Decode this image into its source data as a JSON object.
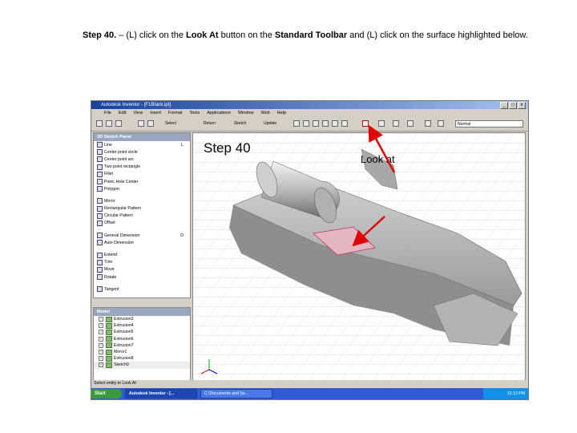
{
  "instruction": {
    "step": "Step 40.",
    "dash": " – (L) click on the ",
    "look_at": "Look At",
    "mid": " button on the ",
    "toolbar_name": "Standard Toolbar",
    "tail": " and (L) click on the surface highlighted below."
  },
  "app": {
    "title": "Autodesk Inventor - [F1Blank.ipt]",
    "title_buttons": [
      "_",
      "□",
      "x"
    ],
    "menus": [
      "File",
      "Edit",
      "View",
      "Insert",
      "Format",
      "Tools",
      "Applications",
      "Window",
      "Web",
      "Help"
    ],
    "toolbar": {
      "select_label": "Select",
      "return_label": "Return",
      "sketch_label": "Sketch",
      "update_label": "Update",
      "style_value": "Normal"
    },
    "sketch_panel": {
      "title": "2D Sketch Panel",
      "tools": [
        {
          "label": "Line",
          "shortcut": "L"
        },
        {
          "label": "Center point circle",
          "shortcut": ""
        },
        {
          "label": "Center point arc",
          "shortcut": ""
        },
        {
          "label": "Two point rectangle",
          "shortcut": ""
        },
        {
          "label": "Fillet",
          "shortcut": ""
        },
        {
          "label": "Point, Hole Center",
          "shortcut": ""
        },
        {
          "label": "Polygon",
          "shortcut": ""
        },
        {
          "label": "Mirror",
          "shortcut": ""
        },
        {
          "label": "Rectangular Pattern",
          "shortcut": ""
        },
        {
          "label": "Circular Pattern",
          "shortcut": ""
        },
        {
          "label": "Offset",
          "shortcut": ""
        },
        {
          "label": "General Dimension",
          "shortcut": "D"
        },
        {
          "label": "Auto Dimension",
          "shortcut": ""
        },
        {
          "label": "Extend",
          "shortcut": ""
        },
        {
          "label": "Trim",
          "shortcut": ""
        },
        {
          "label": "Move",
          "shortcut": ""
        },
        {
          "label": "Rotate",
          "shortcut": ""
        },
        {
          "label": "Tangent",
          "shortcut": ""
        }
      ]
    },
    "model_browser": {
      "title": "Model",
      "items": [
        "Extrusion3",
        "Extrusion4",
        "Extrusion5",
        "Extrusion6",
        "Extrusion7",
        "Mirror1",
        "Extrusion8",
        "Sketch9"
      ]
    },
    "status_text": "Select entity to Look At",
    "taskbar": {
      "start": "Start",
      "tasks": [
        "Autodesk Inventor - [...",
        "C:\\Documents and Se..."
      ],
      "clock": "12:13 PM"
    }
  },
  "annotations": {
    "step_label": "Step 40",
    "look_at_label": "Look at"
  },
  "colors": {
    "arrow": "#e00000",
    "highlight": "#e0a0b0",
    "titlebar": "#1b3f98"
  }
}
